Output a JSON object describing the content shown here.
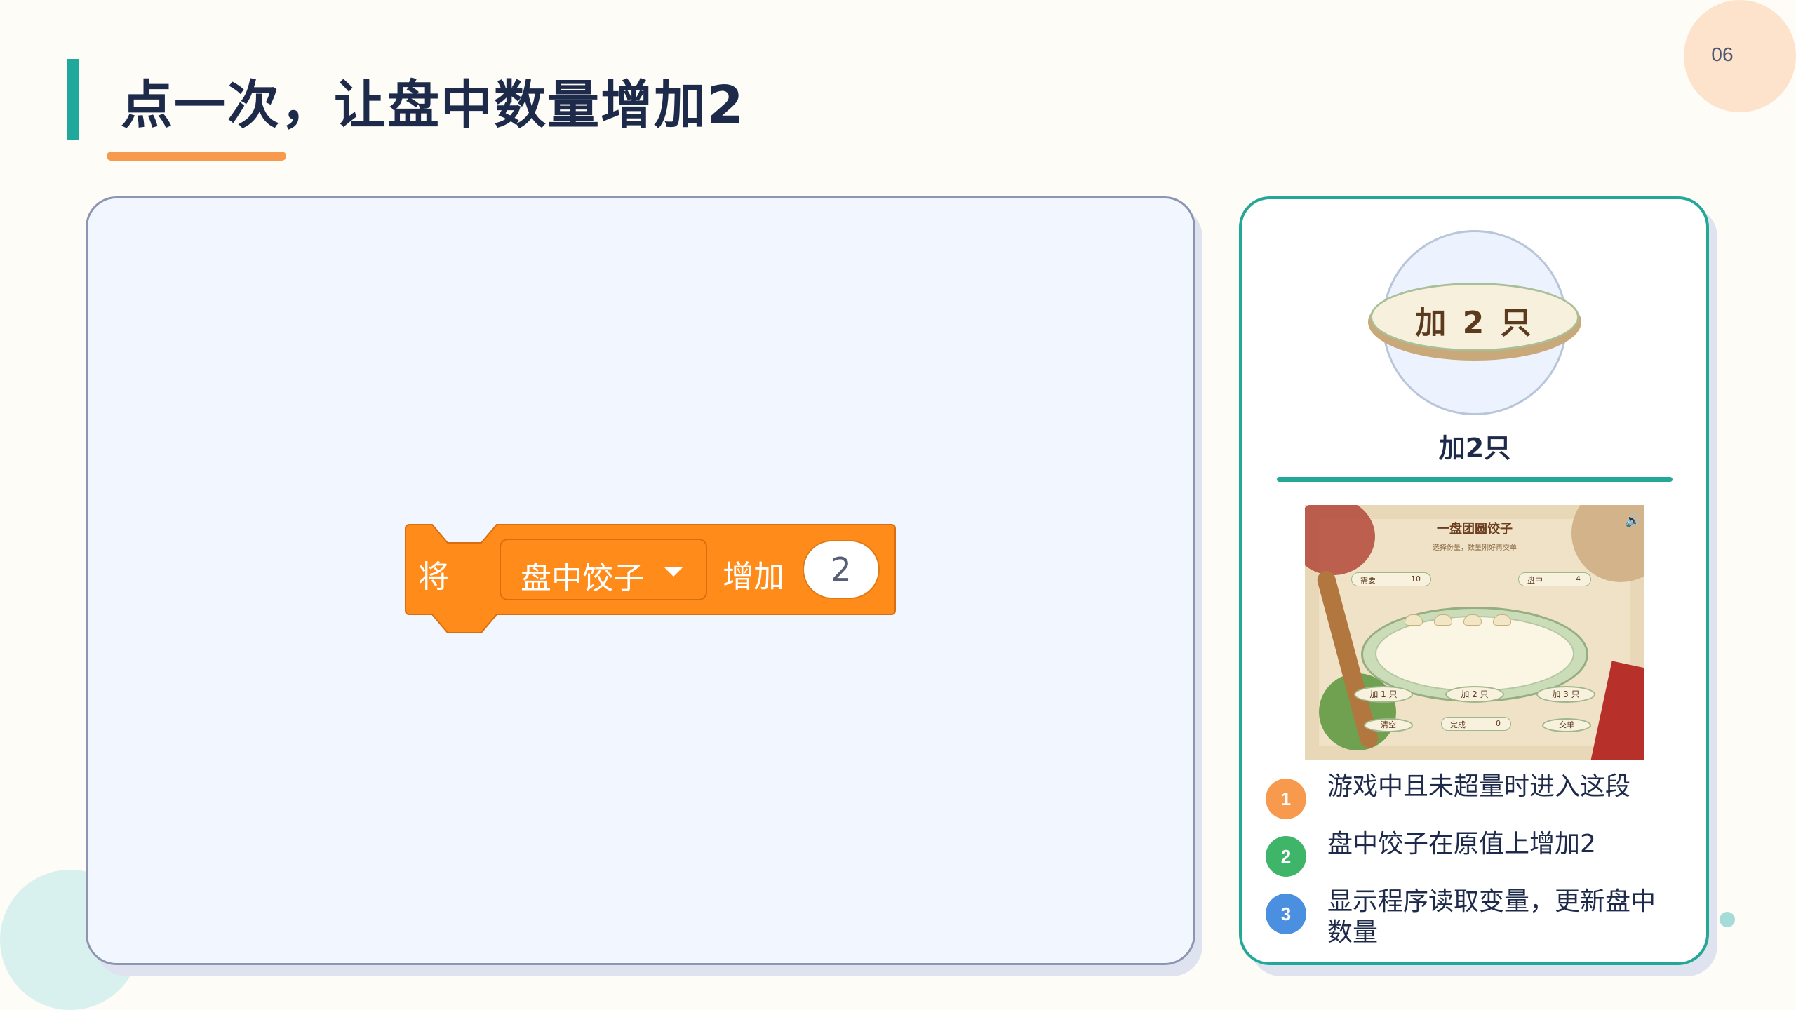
{
  "page_number": "06",
  "title": "点一次，让盘中数量增加2",
  "block": {
    "prefix": "将",
    "variable": "盘中饺子",
    "action": "增加",
    "amount": "2"
  },
  "card": {
    "button_label": "加 2 只",
    "caption": "加2只",
    "game_screenshot": {
      "title": "一盘团圆饺子",
      "subtitle": "选择份量，数量刚好再交单",
      "need_label": "需要",
      "need_value": "10",
      "plate_label": "盘中",
      "plate_value": "4",
      "buttons": [
        "加 1 只",
        "加 2 只",
        "加 3 只"
      ],
      "clear_label": "清空",
      "done_label": "完成",
      "done_value": "0",
      "submit_label": "交单"
    },
    "steps": [
      {
        "number": "1",
        "text": "游戏中且未超量时进入这段",
        "color": "#f79a4e"
      },
      {
        "number": "2",
        "text": "盘中饺子在原值上增加2",
        "color": "#3fb56a"
      },
      {
        "number": "3",
        "text": "显示程序读取变量，更新盘中数量",
        "color": "#4a8fe0"
      }
    ]
  },
  "colors": {
    "accent_teal": "#1fa89b",
    "accent_orange": "#f79a4e",
    "block_orange": "#ff8c1a"
  }
}
